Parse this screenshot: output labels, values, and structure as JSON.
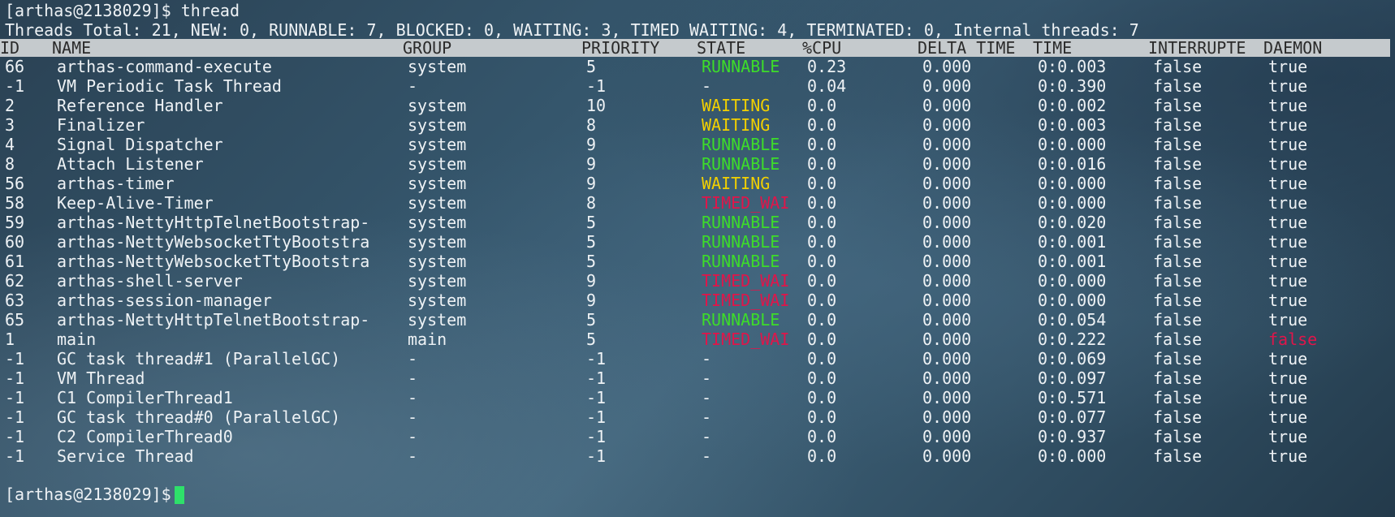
{
  "terminal": {
    "prompt": "[arthas@2138029]$",
    "command": "thread",
    "summary": "Threads Total: 21, NEW: 0, RUNNABLE: 7, BLOCKED: 0, WAITING: 3, TIMED_WAITING: 4, TERMINATED: 0, Internal threads: 7",
    "colors": {
      "runnable": "#3ddc2a",
      "waiting": "#f2d000",
      "timed_waiting": "#e0154a",
      "daemon_false": "#e0154a",
      "cursor": "#2ee06a",
      "header_bg": "#c5cacd"
    }
  },
  "table": {
    "headers": {
      "id": "ID",
      "name": "NAME",
      "group": "GROUP",
      "priority": "PRIORITY",
      "state": "STATE",
      "cpu": "%CPU",
      "delta_time": "DELTA_TIME",
      "time": "TIME",
      "interrupted": "INTERRUPTE",
      "daemon": "DAEMON"
    },
    "rows": [
      {
        "id": "66",
        "name": "arthas-command-execute",
        "group": "system",
        "priority": "5",
        "state": "RUNNABLE",
        "state_kind": "runnable",
        "cpu": "0.23",
        "delta": "0.000",
        "time": "0:0.003",
        "interrupted": "false",
        "daemon": "true"
      },
      {
        "id": "-1",
        "name": "VM Periodic Task Thread",
        "group": "-",
        "priority": "-1",
        "state": "-",
        "state_kind": "none",
        "cpu": "0.04",
        "delta": "0.000",
        "time": "0:0.390",
        "interrupted": "false",
        "daemon": "true"
      },
      {
        "id": "2",
        "name": "Reference Handler",
        "group": "system",
        "priority": "10",
        "state": "WAITING",
        "state_kind": "waiting",
        "cpu": "0.0",
        "delta": "0.000",
        "time": "0:0.002",
        "interrupted": "false",
        "daemon": "true"
      },
      {
        "id": "3",
        "name": "Finalizer",
        "group": "system",
        "priority": "8",
        "state": "WAITING",
        "state_kind": "waiting",
        "cpu": "0.0",
        "delta": "0.000",
        "time": "0:0.003",
        "interrupted": "false",
        "daemon": "true"
      },
      {
        "id": "4",
        "name": "Signal Dispatcher",
        "group": "system",
        "priority": "9",
        "state": "RUNNABLE",
        "state_kind": "runnable",
        "cpu": "0.0",
        "delta": "0.000",
        "time": "0:0.000",
        "interrupted": "false",
        "daemon": "true"
      },
      {
        "id": "8",
        "name": "Attach Listener",
        "group": "system",
        "priority": "9",
        "state": "RUNNABLE",
        "state_kind": "runnable",
        "cpu": "0.0",
        "delta": "0.000",
        "time": "0:0.016",
        "interrupted": "false",
        "daemon": "true"
      },
      {
        "id": "56",
        "name": "arthas-timer",
        "group": "system",
        "priority": "9",
        "state": "WAITING",
        "state_kind": "waiting",
        "cpu": "0.0",
        "delta": "0.000",
        "time": "0:0.000",
        "interrupted": "false",
        "daemon": "true"
      },
      {
        "id": "58",
        "name": "Keep-Alive-Timer",
        "group": "system",
        "priority": "8",
        "state": "TIMED_WAI",
        "state_kind": "timed",
        "cpu": "0.0",
        "delta": "0.000",
        "time": "0:0.000",
        "interrupted": "false",
        "daemon": "true"
      },
      {
        "id": "59",
        "name": "arthas-NettyHttpTelnetBootstrap-",
        "group": "system",
        "priority": "5",
        "state": "RUNNABLE",
        "state_kind": "runnable",
        "cpu": "0.0",
        "delta": "0.000",
        "time": "0:0.020",
        "interrupted": "false",
        "daemon": "true"
      },
      {
        "id": "60",
        "name": "arthas-NettyWebsocketTtyBootstra",
        "group": "system",
        "priority": "5",
        "state": "RUNNABLE",
        "state_kind": "runnable",
        "cpu": "0.0",
        "delta": "0.000",
        "time": "0:0.001",
        "interrupted": "false",
        "daemon": "true"
      },
      {
        "id": "61",
        "name": "arthas-NettyWebsocketTtyBootstra",
        "group": "system",
        "priority": "5",
        "state": "RUNNABLE",
        "state_kind": "runnable",
        "cpu": "0.0",
        "delta": "0.000",
        "time": "0:0.001",
        "interrupted": "false",
        "daemon": "true"
      },
      {
        "id": "62",
        "name": "arthas-shell-server",
        "group": "system",
        "priority": "9",
        "state": "TIMED_WAI",
        "state_kind": "timed",
        "cpu": "0.0",
        "delta": "0.000",
        "time": "0:0.000",
        "interrupted": "false",
        "daemon": "true"
      },
      {
        "id": "63",
        "name": "arthas-session-manager",
        "group": "system",
        "priority": "9",
        "state": "TIMED_WAI",
        "state_kind": "timed",
        "cpu": "0.0",
        "delta": "0.000",
        "time": "0:0.000",
        "interrupted": "false",
        "daemon": "true"
      },
      {
        "id": "65",
        "name": "arthas-NettyHttpTelnetBootstrap-",
        "group": "system",
        "priority": "5",
        "state": "RUNNABLE",
        "state_kind": "runnable",
        "cpu": "0.0",
        "delta": "0.000",
        "time": "0:0.054",
        "interrupted": "false",
        "daemon": "true"
      },
      {
        "id": "1",
        "name": "main",
        "group": "main",
        "priority": "5",
        "state": "TIMED_WAI",
        "state_kind": "timed",
        "cpu": "0.0",
        "delta": "0.000",
        "time": "0:0.222",
        "interrupted": "false",
        "daemon": "false"
      },
      {
        "id": "-1",
        "name": "GC task thread#1 (ParallelGC)",
        "group": "-",
        "priority": "-1",
        "state": "-",
        "state_kind": "none",
        "cpu": "0.0",
        "delta": "0.000",
        "time": "0:0.069",
        "interrupted": "false",
        "daemon": "true"
      },
      {
        "id": "-1",
        "name": "VM Thread",
        "group": "-",
        "priority": "-1",
        "state": "-",
        "state_kind": "none",
        "cpu": "0.0",
        "delta": "0.000",
        "time": "0:0.097",
        "interrupted": "false",
        "daemon": "true"
      },
      {
        "id": "-1",
        "name": "C1 CompilerThread1",
        "group": "-",
        "priority": "-1",
        "state": "-",
        "state_kind": "none",
        "cpu": "0.0",
        "delta": "0.000",
        "time": "0:0.571",
        "interrupted": "false",
        "daemon": "true"
      },
      {
        "id": "-1",
        "name": "GC task thread#0 (ParallelGC)",
        "group": "-",
        "priority": "-1",
        "state": "-",
        "state_kind": "none",
        "cpu": "0.0",
        "delta": "0.000",
        "time": "0:0.077",
        "interrupted": "false",
        "daemon": "true"
      },
      {
        "id": "-1",
        "name": "C2 CompilerThread0",
        "group": "-",
        "priority": "-1",
        "state": "-",
        "state_kind": "none",
        "cpu": "0.0",
        "delta": "0.000",
        "time": "0:0.937",
        "interrupted": "false",
        "daemon": "true"
      },
      {
        "id": "-1",
        "name": "Service Thread",
        "group": "-",
        "priority": "-1",
        "state": "-",
        "state_kind": "none",
        "cpu": "0.0",
        "delta": "0.000",
        "time": "0:0.000",
        "interrupted": "false",
        "daemon": "true"
      }
    ]
  }
}
